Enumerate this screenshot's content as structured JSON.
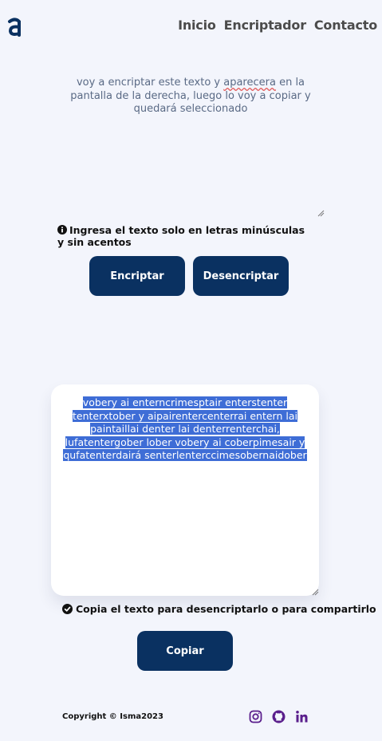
{
  "header": {
    "logo_icon": "a-logo-icon",
    "nav": [
      {
        "label": "Inicio"
      },
      {
        "label": "Encriptador"
      },
      {
        "label": "Contacto"
      }
    ]
  },
  "input": {
    "text_before": "voy a encriptar este texto y  ",
    "misspelled_word": "aparecera",
    "text_after": " en la pantalla de la derecha, luego lo voy a copiar y quedará seleccionado"
  },
  "note": {
    "icon": "info-icon",
    "text": "Ingresa el texto solo en letras minúsculas y sin acentos"
  },
  "buttons": {
    "encrypt": "Encriptar",
    "decrypt": "Desencriptar",
    "copy": "Copiar"
  },
  "output": {
    "lines": [
      "vobery ai enterncrimesptair enterstenter ",
      "tenterxtober y  aipairentercenterrai entern lai ",
      "paintaillai denter lai denterrenterchai, ",
      "lufatentergober lober vobery ai coberpimesair y ",
      "qufatenterdairá senterlenterccimesobernaidober"
    ],
    "selected": true
  },
  "copy_note": {
    "icon": "check-circle-icon",
    "text": "Copia el texto para desencriptarlo o para compartirlo"
  },
  "footer": {
    "copyright": "Copyright © Isma2023",
    "social": [
      "instagram-icon",
      "github-icon",
      "linkedin-icon"
    ]
  },
  "colors": {
    "background": "#f3f5fc",
    "primary": "#0a3161",
    "selection": "#3e6dd6",
    "social": "#5a1e8c"
  }
}
